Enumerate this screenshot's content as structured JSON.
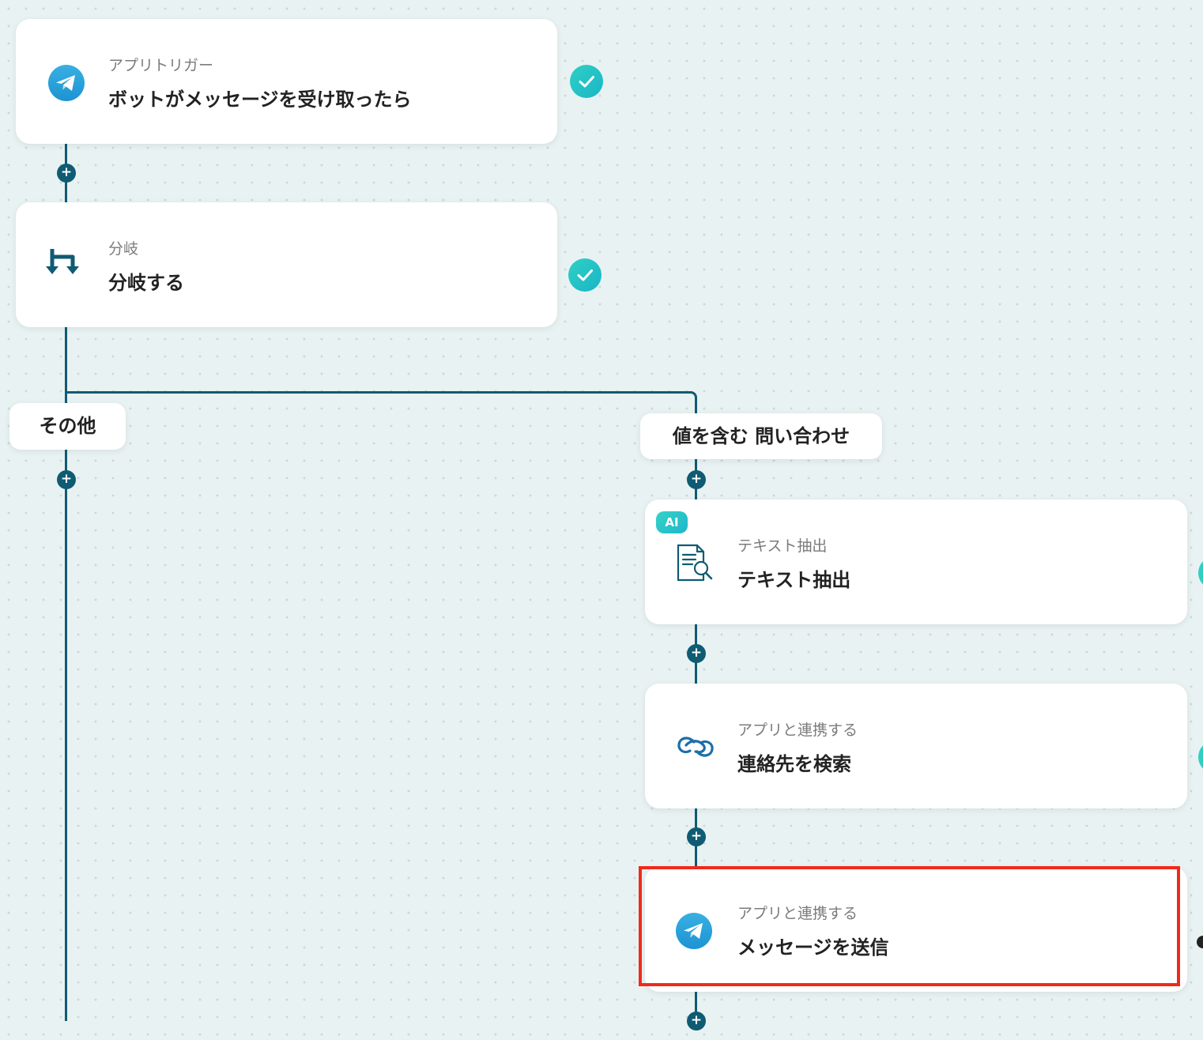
{
  "colors": {
    "canvas_bg": "#e9f2f2",
    "connector": "#0f5b73",
    "check": "#2fd0c4",
    "highlight": "#f02a1a",
    "telegram": "#2ca3df"
  },
  "flow": {
    "trigger": {
      "icon": "telegram-icon",
      "subtitle": "アプリトリガー",
      "title": "ボットがメッセージを受け取ったら",
      "status": "completed"
    },
    "branch": {
      "icon": "branch-icon",
      "subtitle": "分岐",
      "title": "分岐する",
      "status": "completed"
    },
    "branches": {
      "other": {
        "label": "その他"
      },
      "match": {
        "label": "値を含む 問い合わせ",
        "steps": [
          {
            "badge": "AI",
            "icon": "document-search-icon",
            "subtitle": "テキスト抽出",
            "title": "テキスト抽出"
          },
          {
            "icon": "zoho-crm-icon",
            "subtitle": "アプリと連携する",
            "title": "連絡先を検索"
          },
          {
            "icon": "telegram-icon",
            "subtitle": "アプリと連携する",
            "title": "メッセージを送信",
            "highlighted": true
          }
        ]
      }
    },
    "add_step_symbol": "+"
  }
}
